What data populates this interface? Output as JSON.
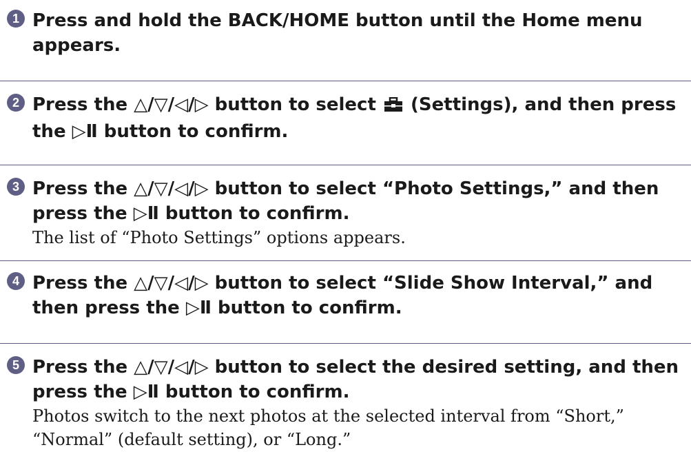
{
  "symbols": {
    "nav": "△/▽/◁/▷",
    "play": "▷Ⅱ"
  },
  "steps": [
    {
      "number": "1",
      "title": "Press and hold the BACK/HOME button until the Home menu appears."
    },
    {
      "number": "2",
      "pre": "Press the ",
      "mid": " button to select ",
      "icon": "toolbox-icon",
      "post": " (Settings), and then press the ",
      "end": " button to confirm."
    },
    {
      "number": "3",
      "pre": "Press the ",
      "mid": " button to select “Photo Settings,” and then press the ",
      "end": " button to confirm.",
      "description": "The list of “Photo Settings” options appears."
    },
    {
      "number": "4",
      "pre": "Press the ",
      "mid": " button to select “Slide Show Interval,” and then press the ",
      "end": " button to confirm."
    },
    {
      "number": "5",
      "pre": "Press the ",
      "mid": " button to select the desired setting, and then press the ",
      "end": " button to confirm.",
      "description": "Photos switch to the next photos at the selected interval from “Short,” “Normal” (default setting), or “Long.”"
    }
  ]
}
